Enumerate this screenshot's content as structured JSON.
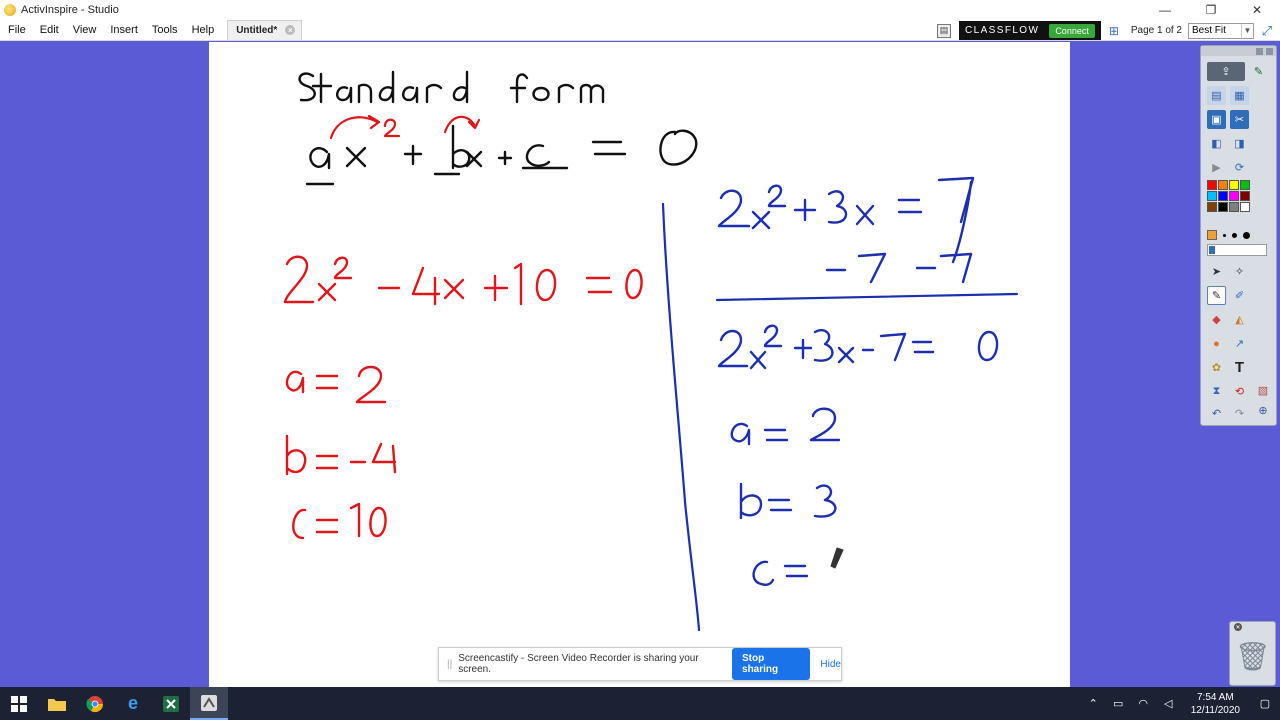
{
  "window": {
    "title": "ActivInspire - Studio",
    "minimize": "—",
    "maximize": "❐",
    "close": "✕"
  },
  "menu": {
    "items": [
      "File",
      "Edit",
      "View",
      "Insert",
      "Tools",
      "Help"
    ],
    "doc_tab": "Untitled*",
    "doc_tab_close": "×"
  },
  "header_right": {
    "classflow_brand": "CLASSFLOW",
    "classflow_connect": "Connect",
    "page_indicator": "Page 1 of 2",
    "zoom_value": "Best Fit"
  },
  "toolbox": {
    "colors": [
      "#ff0000",
      "#ff8000",
      "#ffff00",
      "#00c000",
      "#00c0ff",
      "#0000ff",
      "#ff00ff",
      "#800000",
      "#804000",
      "#000000",
      "#808080",
      "#ffffff"
    ],
    "accent": "#d9dde4"
  },
  "share_bar": {
    "grip": "||",
    "message": "Screencastify - Screen Video Recorder is sharing your screen.",
    "stop_label": "Stop sharing",
    "hide_label": "Hide"
  },
  "taskbar": {
    "time": "7:54 AM",
    "date": "12/11/2020"
  },
  "colors": {
    "background": "#5b5bd6",
    "ink_red": "#e0161b",
    "ink_blue": "#1b2fb0",
    "ink_black": "#111111"
  }
}
